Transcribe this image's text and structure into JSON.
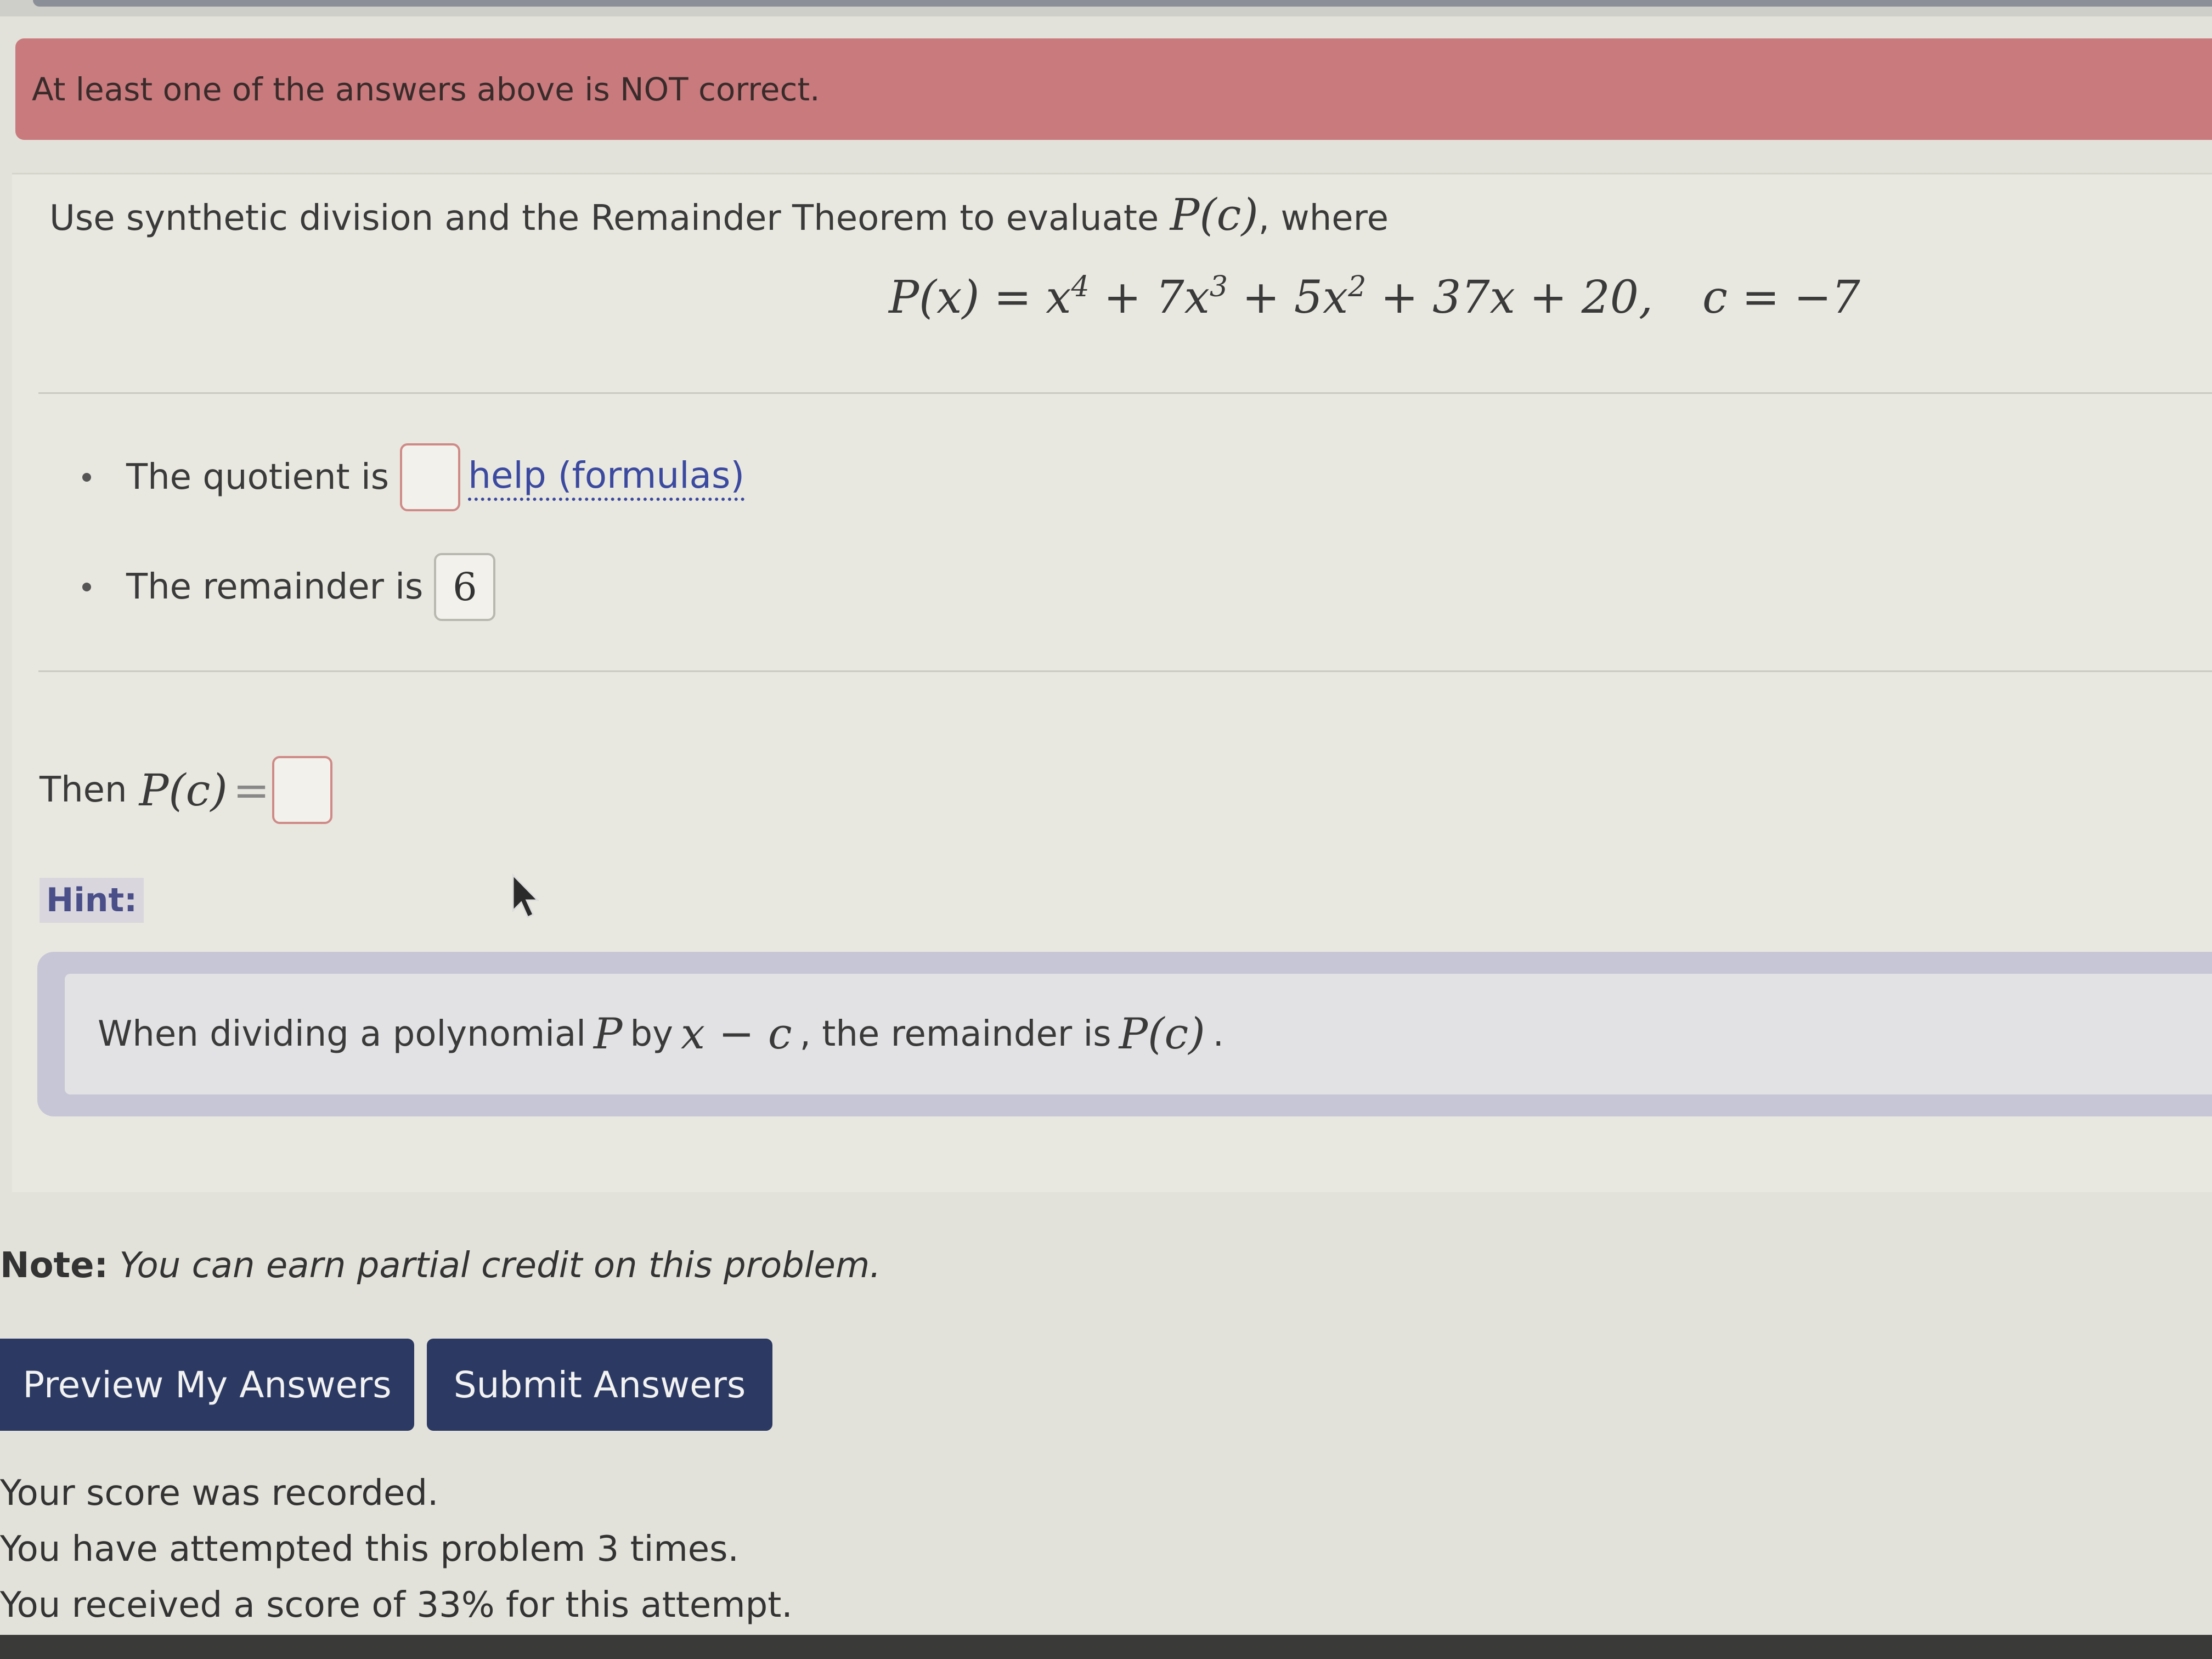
{
  "error_banner": {
    "message": "At least one of the answers above is NOT correct."
  },
  "problem": {
    "prompt_before": "Use synthetic division and the Remainder Theorem to evaluate ",
    "prompt_math": "P(c)",
    "prompt_after": ", where",
    "equation": {
      "lhs": "P(x) = ",
      "terms": [
        "x",
        "4",
        " + 7x",
        "3",
        " + 5x",
        "2",
        " + 37x + 20,"
      ],
      "c_value": "c = −7"
    }
  },
  "answers": {
    "quotient_label": "The quotient is",
    "quotient_value": "",
    "help_link": "help (formulas)",
    "remainder_label": "The remainder is",
    "remainder_value": "6",
    "then_label": "Then",
    "then_math": "P(c)",
    "then_eq": "=",
    "pc_value": ""
  },
  "hint": {
    "label": "Hint:",
    "text_1": "When dividing a polynomial",
    "m_P": "P",
    "text_2": "by",
    "m_xc": "x − c",
    "text_3": ", the remainder is",
    "m_Pc": "P(c)",
    "text_4": "."
  },
  "note": {
    "label": "Note:",
    "text": "You can earn partial credit on this problem."
  },
  "buttons": {
    "preview": "Preview My Answers",
    "submit": "Submit Answers"
  },
  "status": {
    "line1": "Your score was recorded.",
    "line2": "You have attempted this problem 3 times.",
    "line3": "You received a score of 33% for this attempt."
  },
  "colors": {
    "error_banner": "#c87a7d",
    "button": "#2c3a63",
    "link": "#3b4aa0",
    "hint_frame": "#c6c6d6"
  }
}
